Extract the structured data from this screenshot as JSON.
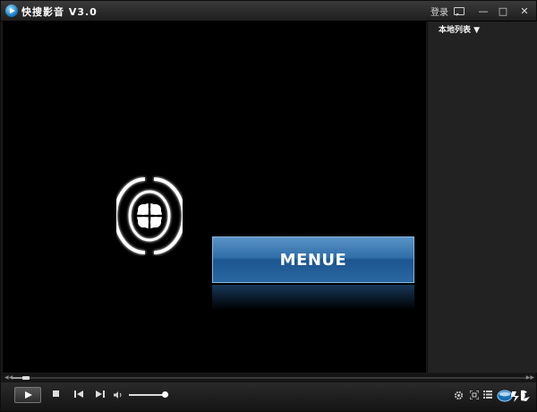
{
  "window": {
    "title": "快搜影音 V3.0",
    "login_label": "登录",
    "minimize": "—",
    "maximize": "□",
    "close": "✕"
  },
  "video": {
    "menu_button_label": "MENUE"
  },
  "playlist": {
    "header_label": "本地列表 ▼"
  },
  "playback": {
    "progress": 0.02,
    "volume": 0.92
  },
  "colors": {
    "menu_blue": "#2f6ea8",
    "background": "#000000",
    "chrome": "#1a1a1a"
  },
  "icons": [
    "app-logo-icon",
    "message-icon",
    "play-icon",
    "stop-icon",
    "previous-icon",
    "next-icon",
    "volume-icon",
    "settings-gear-icon",
    "fullscreen-icon",
    "playlist-icon",
    "brand-logo-icon"
  ]
}
